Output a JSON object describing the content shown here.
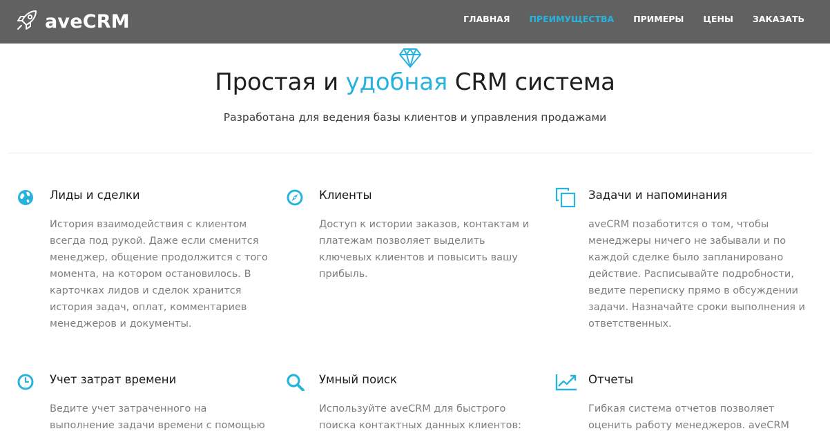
{
  "brand": {
    "name": "aveCRM",
    "logo_icon": "rocket-icon"
  },
  "nav": {
    "items": [
      {
        "label": "ГЛАВНАЯ",
        "active": false
      },
      {
        "label": "ПРЕИМУЩЕСТВА",
        "active": true
      },
      {
        "label": "ПРИМЕРЫ",
        "active": false
      },
      {
        "label": "ЦЕНЫ",
        "active": false
      },
      {
        "label": "ЗАКАЗАТЬ",
        "active": false
      }
    ]
  },
  "hero": {
    "icon": "diamond-icon",
    "title_start": "Простая и ",
    "title_accent": "удобная",
    "title_end": " CRM система",
    "subtitle": "Разработана для ведения базы клиентов и управления продажами"
  },
  "features": [
    {
      "icon": "globe-icon",
      "title": "Лиды и сделки",
      "description": "История взаимодействия с клиентом всегда под рукой. Даже если сменится менеджер, общение продолжится с того момента, на котором остановилось. В карточках лидов и сделок хранится история задач, оплат, комментариев менеджеров и документы."
    },
    {
      "icon": "compass-icon",
      "title": "Клиенты",
      "description": "Доступ к истории заказов, контактам и платежам позволяет выделить ключевых клиентов и повысить вашу прибыль."
    },
    {
      "icon": "copy-icon",
      "title": "Задачи и напоминания",
      "description": "aveCRM позаботится о том, чтобы менеджеры ничего не забывали и по каждой сделке было запланировано действие. Расписывайте подробности, ведите переписку прямо в обсуждении задачи. Назначайте сроки выполнения и ответственных."
    },
    {
      "icon": "clock-icon",
      "title": "Учет затрат времени",
      "description": "Ведите учет затраченного на выполнение задачи времени с помощью таймтрекера"
    },
    {
      "icon": "search-icon",
      "title": "Умный поиск",
      "description": "Используйте aveCRM для быстрого поиска контактных данных клиентов: телефоны,"
    },
    {
      "icon": "trending-up-icon",
      "title": "Отчеты",
      "description": "Гибкая система отчетов позволяет оценить работу менеджеров. aveCRM отслеживает"
    }
  ],
  "colors": {
    "navbar": "#616161",
    "accent": "#28b3dc",
    "text": "#1d1d1d",
    "muted": "#7e7e7e"
  }
}
